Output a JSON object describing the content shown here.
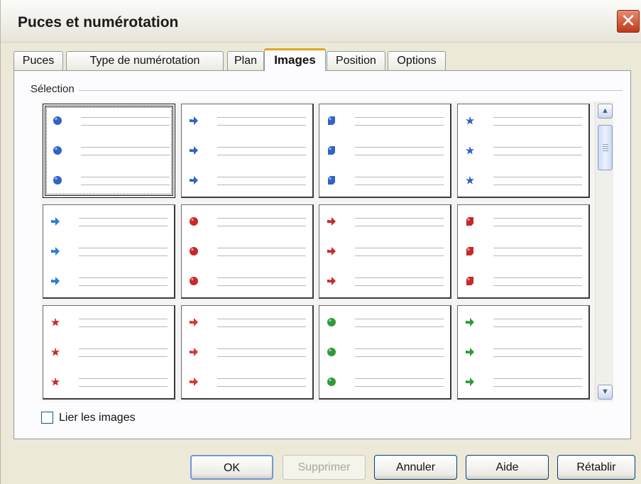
{
  "window": {
    "title": "Puces et numérotation",
    "close_glyph": "✕"
  },
  "tabs": [
    {
      "label": "Puces",
      "active": false
    },
    {
      "label": "Type de numérotation",
      "active": false
    },
    {
      "label": "Plan",
      "active": false
    },
    {
      "label": "Images",
      "active": true
    },
    {
      "label": "Position",
      "active": false
    },
    {
      "label": "Options",
      "active": false
    }
  ],
  "selection_label": "Sélection",
  "bullet_presets": [
    {
      "shape": "sphere",
      "color": "#2f63c8",
      "icon": "blue-sphere-bullet-icon",
      "selected": true
    },
    {
      "shape": "arrow",
      "color": "#2f63c8",
      "icon": "blue-arrow-bullet-icon",
      "selected": false
    },
    {
      "shape": "cube",
      "color": "#2f63c8",
      "icon": "blue-cube-bullet-icon",
      "selected": false
    },
    {
      "shape": "star",
      "color": "#2f63c8",
      "icon": "blue-star-bullet-icon",
      "selected": false
    },
    {
      "shape": "arrow",
      "color": "#2f7ad6",
      "icon": "light-blue-arrow-bullet-icon",
      "selected": false
    },
    {
      "shape": "sphere",
      "color": "#c8282a",
      "icon": "red-sphere-bullet-icon",
      "selected": false
    },
    {
      "shape": "arrow",
      "color": "#c8282a",
      "icon": "red-arrow-bullet-icon",
      "selected": false
    },
    {
      "shape": "cube",
      "color": "#c8282a",
      "icon": "red-cube-bullet-icon",
      "selected": false
    },
    {
      "shape": "star",
      "color": "#c8282a",
      "icon": "red-star-bullet-icon",
      "selected": false
    },
    {
      "shape": "arrow",
      "color": "#d8363a",
      "icon": "red-light-arrow-bullet-icon",
      "selected": false
    },
    {
      "shape": "sphere",
      "color": "#2f9a3a",
      "icon": "green-sphere-bullet-icon",
      "selected": false
    },
    {
      "shape": "arrow",
      "color": "#2f9a3a",
      "icon": "green-arrow-bullet-icon",
      "selected": false
    }
  ],
  "link_images": {
    "label": "Lier les images",
    "checked": false
  },
  "buttons": {
    "ok": "OK",
    "delete": "Supprimer",
    "cancel": "Annuler",
    "help": "Aide",
    "reset": "Rétablir"
  }
}
